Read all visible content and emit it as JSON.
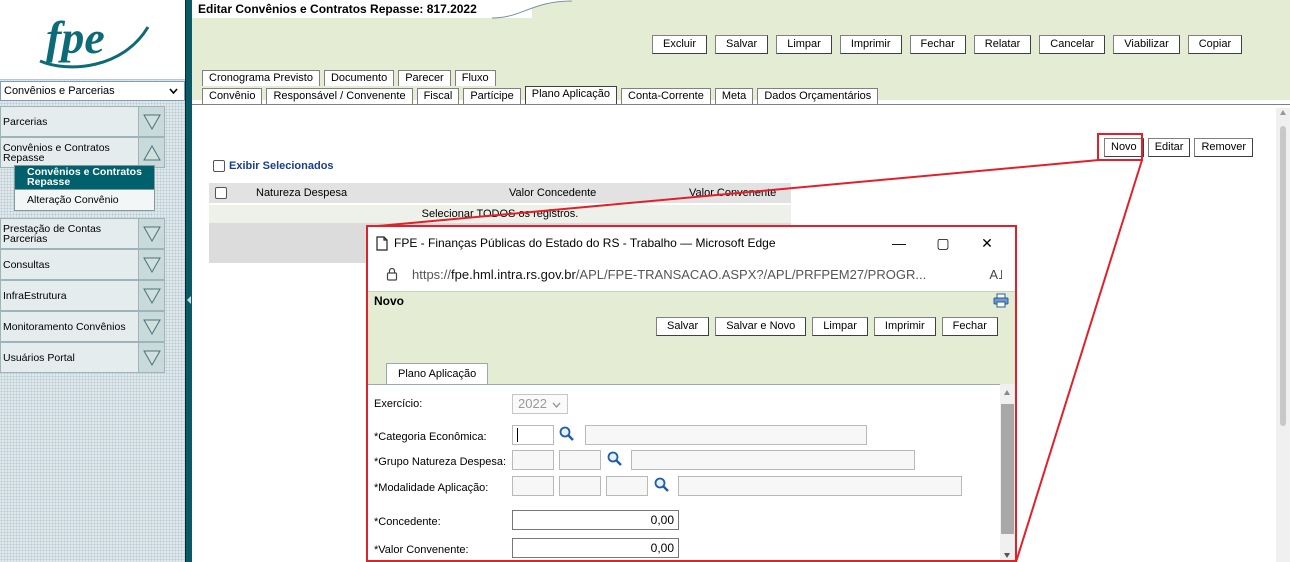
{
  "sidebar": {
    "module_select": "Convênios e Parcerias",
    "groups": [
      {
        "label": "Parcerias"
      },
      {
        "label": "Convênios e Contratos Repasse"
      },
      {
        "label": "Prestação de Contas Parcerias"
      },
      {
        "label": "Consultas"
      },
      {
        "label": "InfraEstrutura"
      },
      {
        "label": "Monitoramento Convênios"
      },
      {
        "label": "Usuários Portal"
      }
    ],
    "subitems": [
      {
        "label": "Convênios e Contratos Repasse",
        "active": true
      },
      {
        "label": "Alteração Convênio",
        "active": false
      }
    ]
  },
  "main": {
    "title": "Editar Convênios e Contratos Repasse: 817.2022",
    "toolbar": [
      "Excluir",
      "Salvar",
      "Limpar",
      "Imprimir",
      "Fechar",
      "Relatar",
      "Cancelar",
      "Viabilizar",
      "Copiar"
    ],
    "tabs_row1": [
      "Cronograma Previsto",
      "Documento",
      "Parecer",
      "Fluxo"
    ],
    "tabs_row2": [
      "Convênio",
      "Responsável / Convenente",
      "Fiscal",
      "Partícipe",
      "Plano Aplicação",
      "Conta-Corrente",
      "Meta",
      "Dados Orçamentários"
    ],
    "active_tab": "Plano Aplicação",
    "list_buttons": [
      "Novo",
      "Editar",
      "Remover"
    ],
    "exibir_label": "Exibir Selecionados",
    "grid": {
      "columns": [
        "Natureza Despesa",
        "Valor Concedente",
        "Valor Convenente"
      ],
      "select_all": "Selecionar TODOS os registros."
    }
  },
  "popup": {
    "window_title": "FPE - Finanças Públicas do Estado do RS - Trabalho — Microsoft Edge",
    "url_scheme": "https://",
    "url_host": "fpe.hml.intra.rs.gov.br",
    "url_path": "/APL/FPE-TRANSACAO.ASPX?/APL/PRFPEM27/PROGR...",
    "header": "Novo",
    "toolbar": [
      "Salvar",
      "Salvar e Novo",
      "Limpar",
      "Imprimir",
      "Fechar"
    ],
    "tab": "Plano Aplicação",
    "form": {
      "exercicio_label": "Exercício:",
      "exercicio_value": "2022",
      "categoria_label": "*Categoria Econômica:",
      "grupo_label": "*Grupo Natureza Despesa:",
      "modalidade_label": "*Modalidade Aplicação:",
      "concedente_label": "*Concedente:",
      "concedente_value": "0,00",
      "convenente_label": "*Valor Convenente:",
      "convenente_value": "0,00"
    }
  },
  "colors": {
    "accent": "#00606c",
    "highlight": "#e0212a",
    "panel": "#e4ecd4"
  }
}
